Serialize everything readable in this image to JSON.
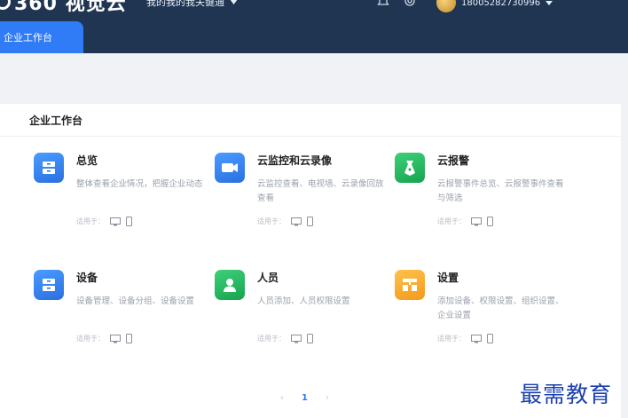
{
  "header": {
    "logo_text": "360 视觉云",
    "enterprise_switch": "我的我的我关键通",
    "user_phone": "18005282730996"
  },
  "tabs": [
    {
      "label": "企业工作台",
      "active": true
    }
  ],
  "panel": {
    "title": "企业工作台"
  },
  "applies_label": "适用于：",
  "cards": [
    {
      "title": "总览",
      "desc": "整体查看企业情况，把握企业动态",
      "icon": "overview-icon",
      "color": "blue"
    },
    {
      "title": "云监控和云录像",
      "desc": "云监控查看、电视墙、云录像回放查看",
      "icon": "camera-icon",
      "color": "blue"
    },
    {
      "title": "云报警",
      "desc": "云报警事件总览、云报警事件查看与筛选",
      "icon": "alarm-icon",
      "color": "green"
    },
    {
      "title": "设备",
      "desc": "设备管理、设备分组、设备设置",
      "icon": "device-icon",
      "color": "blue"
    },
    {
      "title": "人员",
      "desc": "人员添加、人员权限设置",
      "icon": "person-icon",
      "color": "green"
    },
    {
      "title": "设置",
      "desc": "添加设备、权限设置、组织设置、企业设置",
      "icon": "settings-org-icon",
      "color": "orange"
    }
  ],
  "pager": {
    "prev": "‹",
    "current": "1",
    "next": "›"
  },
  "watermark": "最需教育"
}
